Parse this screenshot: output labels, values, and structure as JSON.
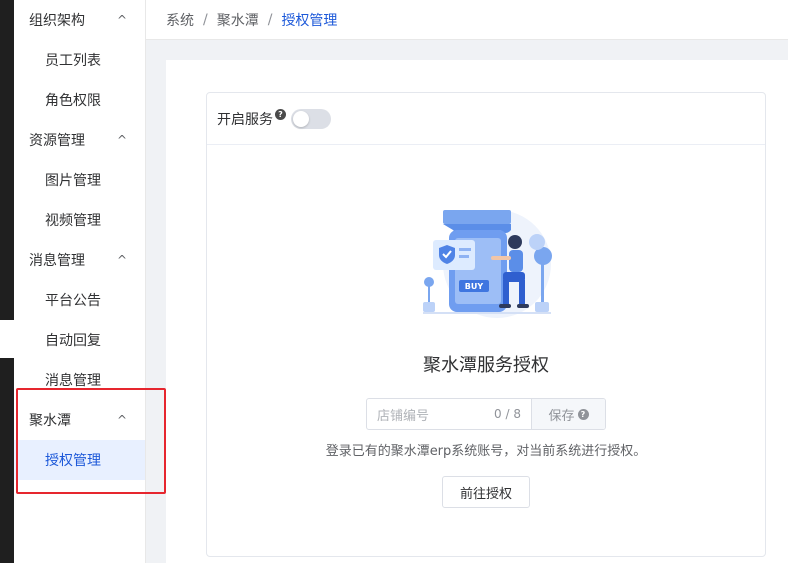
{
  "sidebar": {
    "groups": [
      {
        "label": "组织架构",
        "items": [
          "员工列表",
          "角色权限"
        ]
      },
      {
        "label": "资源管理",
        "items": [
          "图片管理",
          "视频管理"
        ]
      },
      {
        "label": "消息管理",
        "items": [
          "平台公告",
          "自动回复",
          "消息管理"
        ]
      },
      {
        "label": "聚水潭",
        "items": [
          "授权管理"
        ]
      }
    ],
    "active_item": "授权管理",
    "chevron_glyph": "^"
  },
  "breadcrumb": {
    "items": [
      "系统",
      "聚水潭",
      "授权管理"
    ],
    "separator": "/"
  },
  "card": {
    "service_label": "开启服务",
    "help_glyph": "?",
    "toggle_on": false,
    "illustration_badge": "BUY",
    "title": "聚水潭服务授权",
    "input": {
      "placeholder": "店铺编号",
      "value": "",
      "count": "0 / 8"
    },
    "save_label": "保存",
    "hint": "登录已有的聚水潭erp系统账号，对当前系统进行授权。",
    "goto_label": "前往授权"
  },
  "colors": {
    "accent": "#1d59d9",
    "highlight_border": "#e6262e",
    "active_bg": "#e8f0ff"
  }
}
